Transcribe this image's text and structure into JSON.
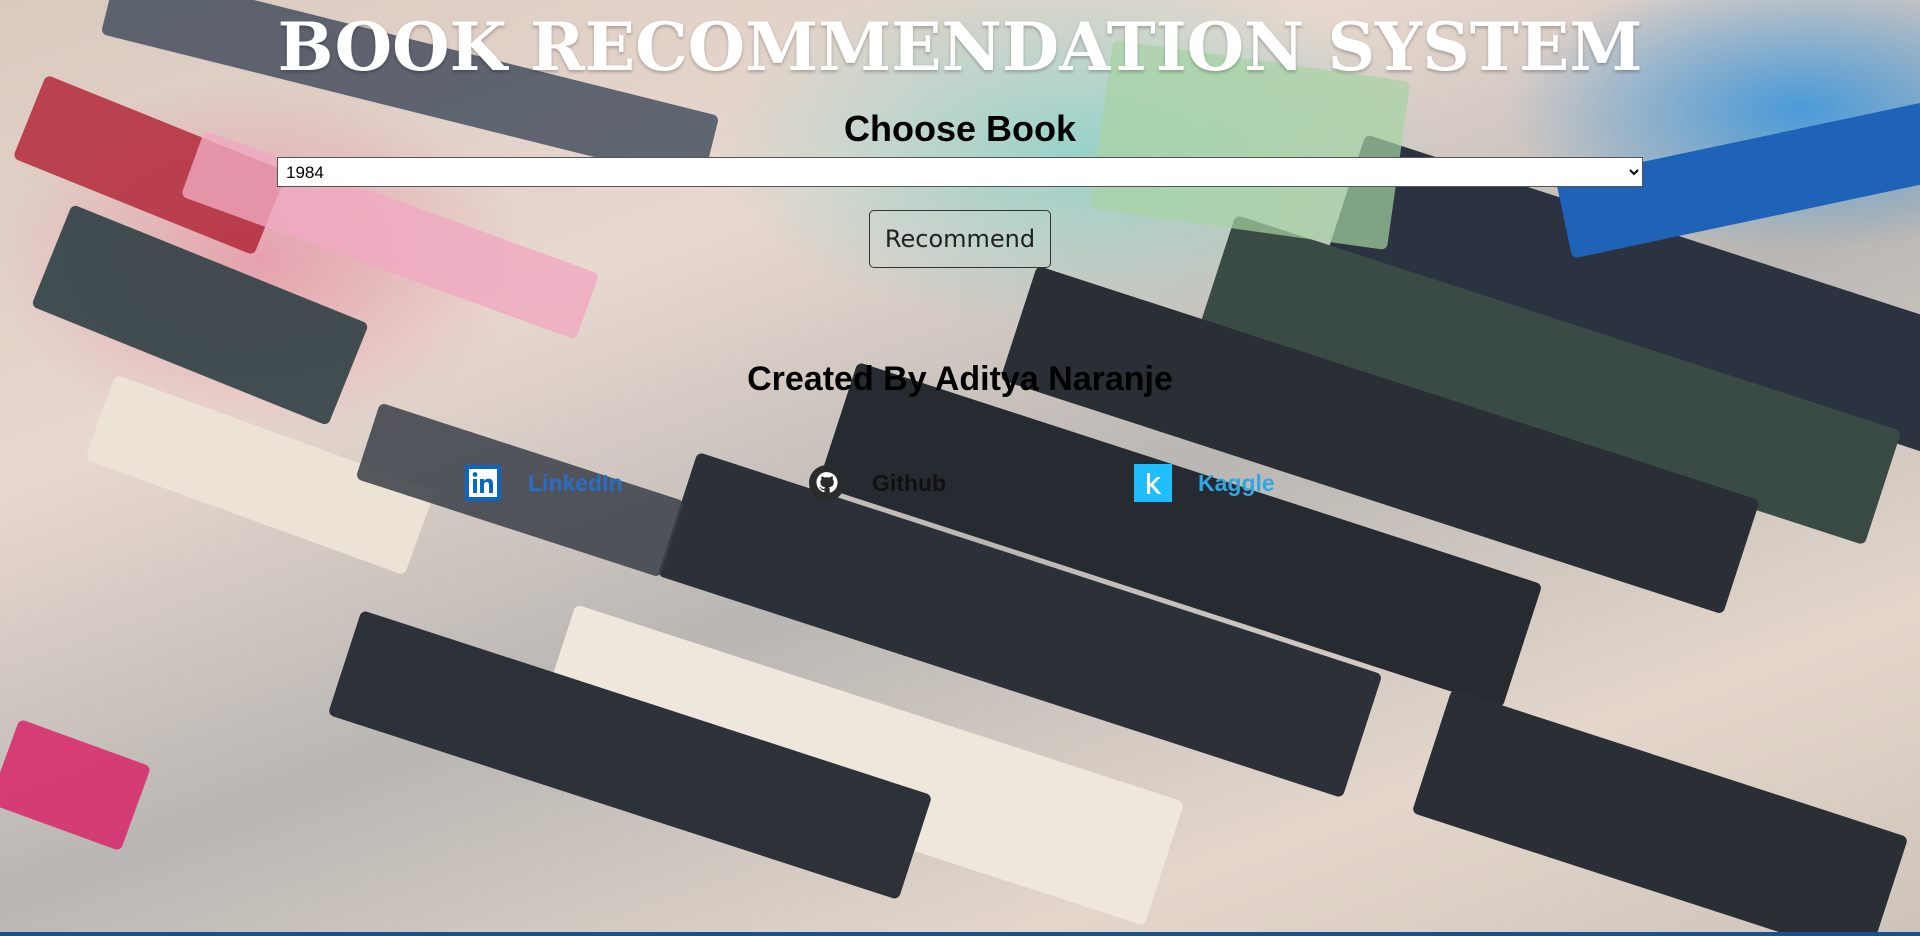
{
  "header": {
    "title": "BOOK RECOMMENDATION SYSTEM",
    "subtitle": "Choose Book"
  },
  "form": {
    "selected_book": "1984",
    "options": [
      "1984"
    ],
    "button_label": "Recommend"
  },
  "footer": {
    "creator_text": "Created By Aditya Naranje",
    "links": [
      {
        "label": "LinkedIn",
        "icon": "linkedin-icon",
        "color": "#2b6cc7"
      },
      {
        "label": "Github",
        "icon": "github-icon",
        "color": "#111111"
      },
      {
        "label": "Kaggle",
        "icon": "kaggle-icon",
        "color": "#2fa8e0"
      }
    ]
  },
  "colors": {
    "title": "#ffffff",
    "linkedin_brand": "#0a66c2",
    "kaggle_brand": "#20beff",
    "bottom_bar": "#1d4f8a"
  }
}
